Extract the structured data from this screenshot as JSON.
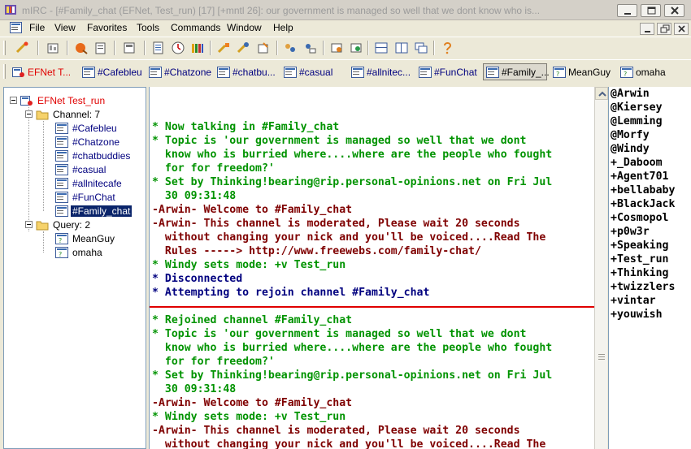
{
  "window": {
    "title": "mIRC - [#Family_chat (EFNet, Test_run) [17] [+mntl 26]: our government is managed so well that we dont know who is...",
    "app_icon": "mirc-app-icon"
  },
  "menu": {
    "items": [
      "File",
      "View",
      "Favorites",
      "Tools",
      "Commands",
      "Window",
      "Help"
    ]
  },
  "toolbar": {
    "buttons": [
      "connect-icon",
      "options-icon",
      "favorites-icon",
      "address-book-icon",
      "colors-icon",
      "log-icon",
      "timer-icon",
      "dcc-icon",
      "scripts-icon",
      "url-icon",
      "notify-icon",
      "channels-icon",
      "dcc-send-icon",
      "dcc-chat-icon",
      "received-icon",
      "tile-icon",
      "cascade-icon",
      "arrange-icon",
      "help-icon"
    ]
  },
  "switchbar": {
    "tabs": [
      {
        "label": "EFNet T...",
        "color": "#e00000",
        "icon": "server-icon"
      },
      {
        "label": "#Cafebleu",
        "color": "#00007f",
        "icon": "channel-icon"
      },
      {
        "label": "#Chatzone",
        "color": "#00007f",
        "icon": "channel-icon"
      },
      {
        "label": "#chatbu...",
        "color": "#00007f",
        "icon": "channel-icon"
      },
      {
        "label": "#casual",
        "color": "#00007f",
        "icon": "channel-icon"
      },
      {
        "label": "#allnitec...",
        "color": "#00007f",
        "icon": "channel-icon"
      },
      {
        "label": "#FunChat",
        "color": "#00007f",
        "icon": "channel-icon"
      },
      {
        "label": "#Family_...",
        "color": "#000000",
        "icon": "channel-icon",
        "active": true
      },
      {
        "label": "MeanGuy",
        "color": "#000000",
        "icon": "query-icon"
      },
      {
        "label": "omaha",
        "color": "#000000",
        "icon": "query-icon"
      }
    ]
  },
  "tree": {
    "server": "EFNet Test_run",
    "channel_folder": "Channel: 7",
    "channels": [
      "#Cafebleu",
      "#Chatzone",
      "#chatbuddies",
      "#casual",
      "#allnitecafe",
      "#FunChat",
      "#Family_chat"
    ],
    "query_folder": "Query: 2",
    "queries": [
      "MeanGuy",
      "omaha"
    ],
    "selected": "#Family_chat"
  },
  "chat": {
    "lines": [
      {
        "text": "* Now talking in #Family_chat",
        "color": "green"
      },
      {
        "text": "* Topic is 'our government is managed so well that we dont",
        "color": "green"
      },
      {
        "text": "  know who is burried where....where are the people who fought",
        "color": "green"
      },
      {
        "text": "  for for freedom?'",
        "color": "green"
      },
      {
        "text": "* Set by Thinking!bearing@rip.personal-opinions.net on Fri Jul",
        "color": "green"
      },
      {
        "text": "  30 09:31:48",
        "color": "green"
      },
      {
        "text": "-Arwin- Welcome to #Family_chat",
        "color": "red"
      },
      {
        "text": "-Arwin- This channel is moderated, Please wait 20 seconds",
        "color": "red"
      },
      {
        "text": "  without changing your nick and you'll be voiced....Read The",
        "color": "red"
      },
      {
        "text": "  Rules -----> http://www.freewebs.com/family-chat/",
        "color": "red"
      },
      {
        "text": "* Windy sets mode: +v Test_run",
        "color": "green"
      },
      {
        "text": "* Disconnected",
        "color": "navy"
      },
      {
        "text": "* Attempting to rejoin channel #Family_chat",
        "color": "navy"
      },
      {
        "text": "",
        "color": "marker"
      },
      {
        "text": "* Rejoined channel #Family_chat",
        "color": "green"
      },
      {
        "text": "* Topic is 'our government is managed so well that we dont",
        "color": "green"
      },
      {
        "text": "  know who is burried where....where are the people who fought",
        "color": "green"
      },
      {
        "text": "  for for freedom?'",
        "color": "green"
      },
      {
        "text": "* Set by Thinking!bearing@rip.personal-opinions.net on Fri Jul",
        "color": "green"
      },
      {
        "text": "  30 09:31:48",
        "color": "green"
      },
      {
        "text": "-Arwin- Welcome to #Family_chat",
        "color": "red"
      },
      {
        "text": "* Windy sets mode: +v Test_run",
        "color": "green"
      },
      {
        "text": "-Arwin- This channel is moderated, Please wait 20 seconds",
        "color": "red"
      },
      {
        "text": "  without changing your nick and you'll be voiced....Read The",
        "color": "red"
      }
    ]
  },
  "nicklist": {
    "nicks": [
      "@Arwin",
      "@Kiersey",
      "@Lemming",
      "@Morfy",
      "@Windy",
      "+_Daboom",
      "+Agent701",
      "+bellababy",
      "+BlackJack",
      "+Cosmopol",
      "+p0w3r",
      "+Speaking",
      "+Test_run",
      "+Thinking",
      "+twizzlers",
      "+vintar",
      "+youwish"
    ]
  }
}
